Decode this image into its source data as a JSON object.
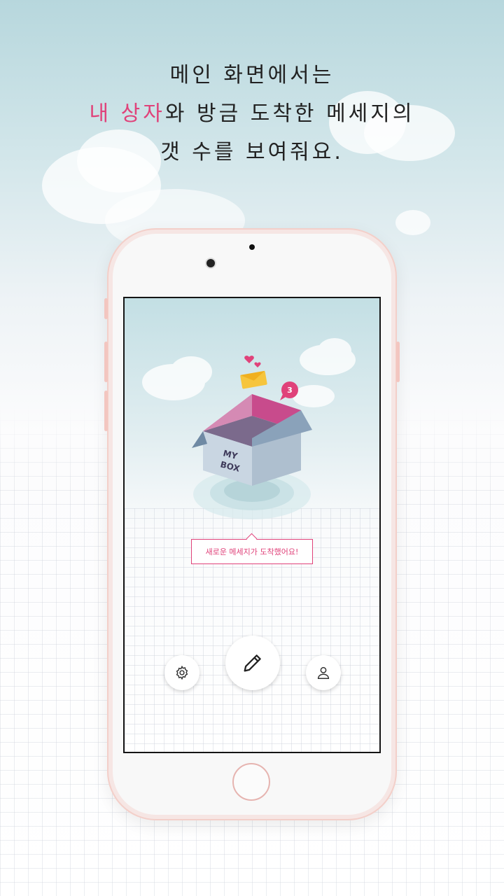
{
  "headline": {
    "line1": "메인 화면에서는",
    "line2_accent": "내 상자",
    "line2_rest": "와 방금 도착한 메세지의",
    "line3": "갯 수를 보여줘요."
  },
  "box": {
    "label_line1": "MY",
    "label_line2": "BOX",
    "message_count": "3"
  },
  "notice": {
    "text": "새로운 메세지가 도착했어요!"
  },
  "icons": {
    "settings": "gear-icon",
    "compose": "pencil-icon",
    "profile": "user-icon"
  },
  "colors": {
    "accent": "#e0427a",
    "box_top": "#c84b8c",
    "box_side": "#b7c7d6"
  }
}
